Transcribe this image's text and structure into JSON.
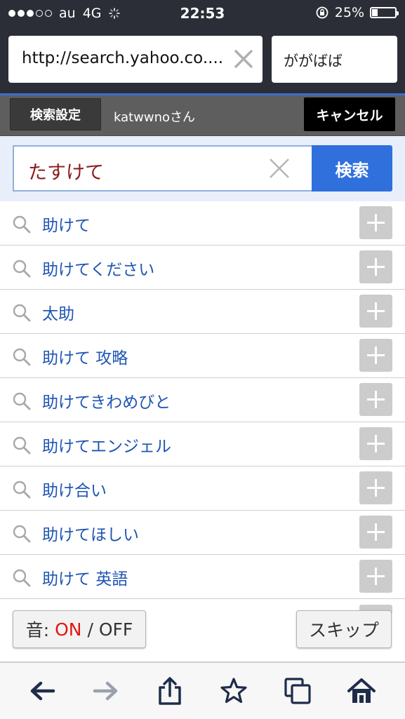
{
  "status_bar": {
    "carrier": "au",
    "network": "4G",
    "time": "22:53",
    "battery": "25%",
    "battery_level": 0.25
  },
  "browser": {
    "url": "http://search.yahoo.co....",
    "search_field": "ががばば"
  },
  "settings_bar": {
    "settings_label": "検索設定",
    "user": "katwwnoさん",
    "cancel_label": "キャンセル"
  },
  "search": {
    "query": "たすけて",
    "button_label": "検索"
  },
  "suggestions": [
    "助けて",
    "助けてください",
    "太助",
    "助けて 攻略",
    "助けてきわめびと",
    "助けてエンジェル",
    "助け合い",
    "助けてほしい",
    "助けて 英語"
  ],
  "sound_toggle": {
    "prefix": "音: ",
    "on": "ON",
    "separator": " / ",
    "off": "OFF"
  },
  "skip_label": "スキップ",
  "colors": {
    "topbar": "#2b2e36",
    "accent_blue": "#2f70dc",
    "suggestion_text": "#1f55b3",
    "query_text": "#8b1b1b",
    "on_red": "#e01515"
  },
  "icons": {
    "back": "back-arrow-icon",
    "forward": "forward-arrow-icon",
    "share": "share-icon",
    "bookmark": "star-icon",
    "tabs": "tabs-icon",
    "home": "home-icon"
  }
}
